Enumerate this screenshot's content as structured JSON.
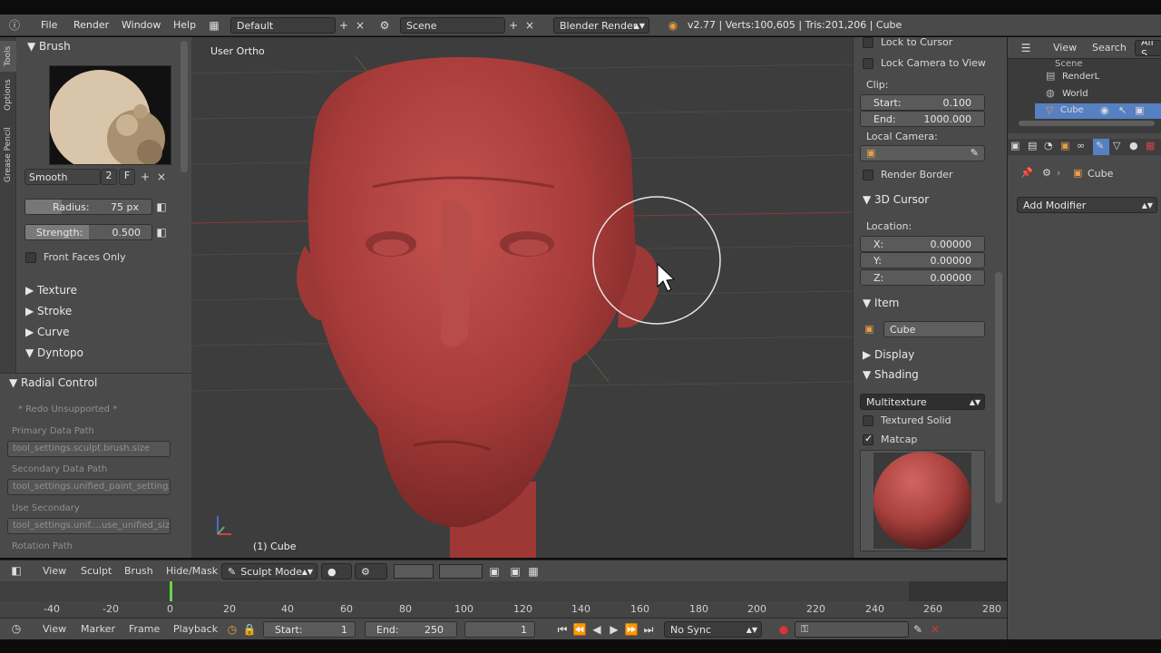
{
  "menubar": {
    "items": [
      "File",
      "Render",
      "Window",
      "Help"
    ],
    "layout": "Default",
    "scene": "Scene",
    "engine": "Blender Render",
    "stats": "v2.77 | Verts:100,605 | Tris:201,206 | Cube"
  },
  "tool_tabs": [
    "Tools",
    "Options",
    "Grease Pencil"
  ],
  "brush_panel": {
    "title": "Brush",
    "brush_name": "Smooth",
    "users": "2",
    "fake_user": "F",
    "radius_label": "Radius:",
    "radius_value": "75 px",
    "strength_label": "Strength:",
    "strength_value": "0.500",
    "strength_fraction": 0.5,
    "front_faces": "Front Faces Only",
    "sections": [
      "Texture",
      "Stroke",
      "Curve",
      "Dyntopo"
    ]
  },
  "redo_panel": {
    "title": "Radial Control",
    "unsupported": "* Redo Unsupported *",
    "primary_label": "Primary Data Path",
    "primary_value": "tool_settings.sculpt.brush.size",
    "secondary_label": "Secondary Data Path",
    "secondary_value": "tool_settings.unified_paint_setting...",
    "use_secondary_label": "Use Secondary",
    "use_secondary_value": "tool_settings.unif....use_unified_size",
    "rotation_label": "Rotation Path"
  },
  "viewport": {
    "view_name": "User Ortho",
    "object_label": "(1) Cube"
  },
  "view_panel": {
    "lock_cursor": "Lock to Cursor",
    "lock_camera": "Lock Camera to View",
    "clip_label": "Clip:",
    "clip_start_label": "Start:",
    "clip_start": "0.100",
    "clip_end_label": "End:",
    "clip_end": "1000.000",
    "local_camera": "Local Camera:",
    "render_border": "Render Border",
    "cursor_title": "3D Cursor",
    "location_label": "Location:",
    "x_label": "X:",
    "x": "0.00000",
    "y_label": "Y:",
    "y": "0.00000",
    "z_label": "Z:",
    "z": "0.00000",
    "item_title": "Item",
    "item_name": "Cube",
    "display_title": "Display",
    "shading_title": "Shading",
    "shading_mode": "Multitexture",
    "textured_solid": "Textured Solid",
    "matcap": "Matcap"
  },
  "outliner": {
    "view_menu": "View",
    "search_menu": "Search",
    "filter": "All S",
    "items": [
      "Scene",
      "RenderL",
      "World",
      "Cube"
    ]
  },
  "properties": {
    "object_name": "Cube",
    "add_modifier": "Add Modifier"
  },
  "header3d": {
    "view": "View",
    "sculpt": "Sculpt",
    "brush": "Brush",
    "hide_mask": "Hide/Mask",
    "mode": "Sculpt Mode"
  },
  "timeline": {
    "ticks": [
      "-40",
      "-20",
      "0",
      "20",
      "40",
      "60",
      "80",
      "100",
      "120",
      "140",
      "160",
      "180",
      "200",
      "220",
      "240",
      "260",
      "280"
    ],
    "view": "View",
    "marker": "Marker",
    "frame": "Frame",
    "playback": "Playback",
    "start_label": "Start:",
    "start": "1",
    "end_label": "End:",
    "end": "250",
    "current": "1",
    "sync": "No Sync"
  },
  "colors": {
    "sculpt_red": "#b3413f",
    "ui_bg": "#4a4a4a",
    "viewport_bg": "#3d3d3d",
    "highlight_blue": "#5680c2",
    "timeline_green": "#6bd44a"
  }
}
